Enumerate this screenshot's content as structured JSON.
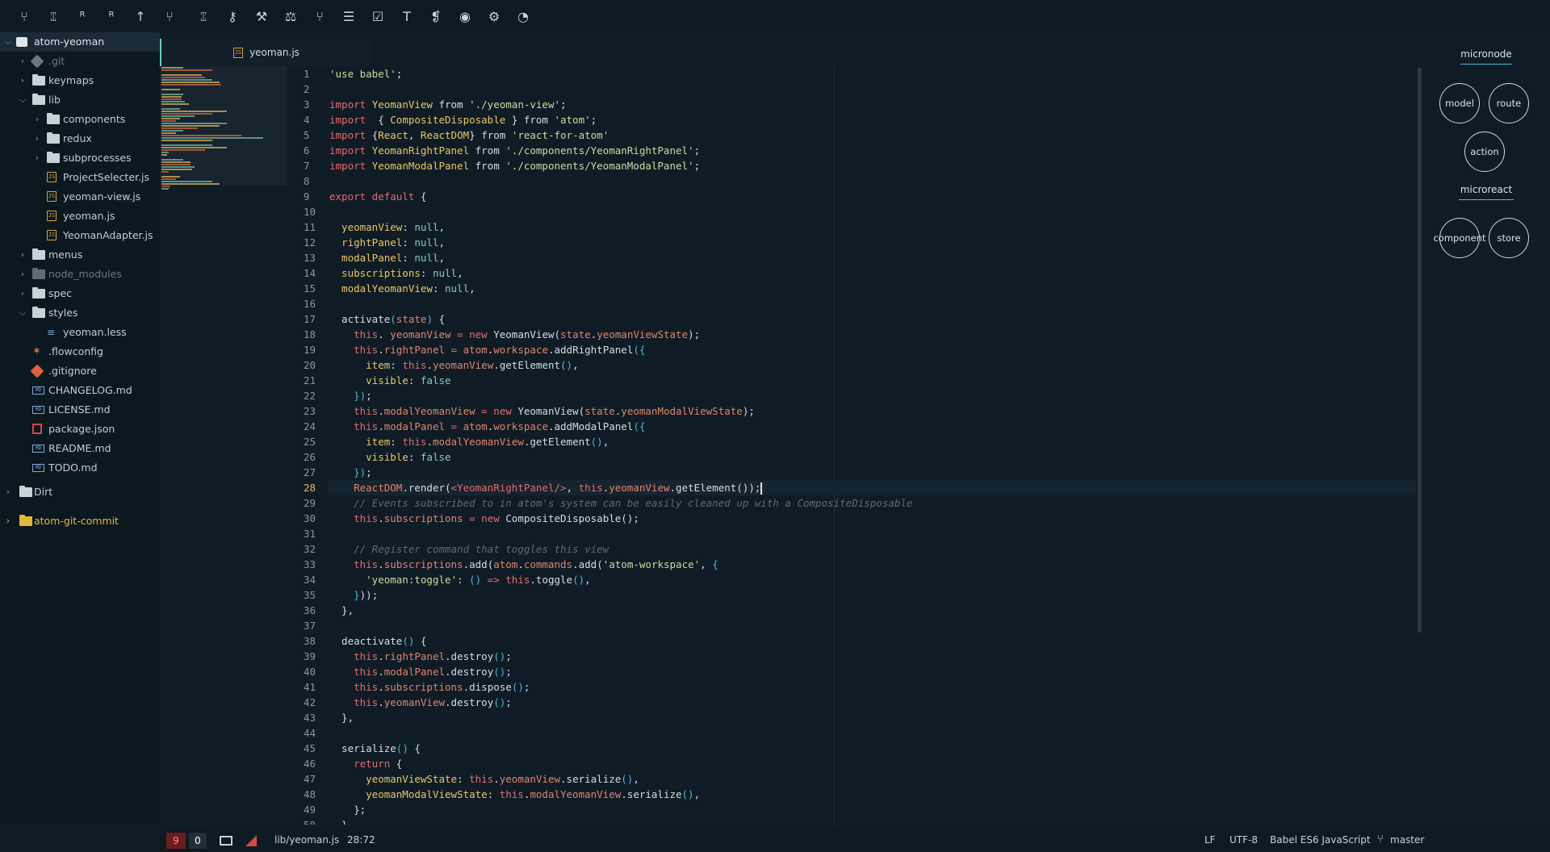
{
  "toolbar": {
    "icons": [
      "git-branch-icon",
      "git-merge-icon",
      "git-pull-icon",
      "git-fetch-icon",
      "git-push-icon",
      "git-stash-icon",
      "git-graph-icon",
      "key-icon",
      "wrench-icon",
      "balance-icon",
      "git-compare-icon",
      "list-icon",
      "checklist-icon",
      "text-icon",
      "layers-icon",
      "eye-icon",
      "gear-icon",
      "dashboard-icon"
    ],
    "glyphs": [
      "⑂",
      "⑄",
      "ᴿ",
      "ᴿ",
      "↑",
      "⑂",
      "⑄",
      "⚷",
      "⚒",
      "⚖",
      "⑂",
      "☰",
      "☑",
      "T",
      "❡",
      "◉",
      "⚙",
      "◔"
    ]
  },
  "sidebar": {
    "root": "atom-yeoman",
    "items": [
      {
        "label": ".git",
        "depth": 1,
        "kind": "git",
        "arrow": "›",
        "dim": true
      },
      {
        "label": "keymaps",
        "depth": 1,
        "kind": "folder",
        "arrow": "›"
      },
      {
        "label": "lib",
        "depth": 1,
        "kind": "folder",
        "arrow": "⌵"
      },
      {
        "label": "components",
        "depth": 2,
        "kind": "folder",
        "arrow": "›"
      },
      {
        "label": "redux",
        "depth": 2,
        "kind": "folder",
        "arrow": "›"
      },
      {
        "label": "subprocesses",
        "depth": 2,
        "kind": "folder",
        "arrow": "›"
      },
      {
        "label": "ProjectSelecter.js",
        "depth": 2,
        "kind": "js"
      },
      {
        "label": "yeoman-view.js",
        "depth": 2,
        "kind": "js"
      },
      {
        "label": "yeoman.js",
        "depth": 2,
        "kind": "js"
      },
      {
        "label": "YeomanAdapter.js",
        "depth": 2,
        "kind": "js"
      },
      {
        "label": "menus",
        "depth": 1,
        "kind": "folder",
        "arrow": "›"
      },
      {
        "label": "node_modules",
        "depth": 1,
        "kind": "folder",
        "arrow": "›",
        "dim": true
      },
      {
        "label": "spec",
        "depth": 1,
        "kind": "folder",
        "arrow": "›"
      },
      {
        "label": "styles",
        "depth": 1,
        "kind": "folder",
        "arrow": "⌵"
      },
      {
        "label": "yeoman.less",
        "depth": 2,
        "kind": "less"
      },
      {
        "label": ".flowconfig",
        "depth": 1,
        "kind": "flow"
      },
      {
        "label": ".gitignore",
        "depth": 1,
        "kind": "git"
      },
      {
        "label": "CHANGELOG.md",
        "depth": 1,
        "kind": "md"
      },
      {
        "label": "LICENSE.md",
        "depth": 1,
        "kind": "md"
      },
      {
        "label": "package.json",
        "depth": 1,
        "kind": "pkg"
      },
      {
        "label": "README.md",
        "depth": 1,
        "kind": "md"
      },
      {
        "label": "TODO.md",
        "depth": 1,
        "kind": "md"
      }
    ],
    "other_roots": [
      {
        "label": "Dirt",
        "kind": "folder",
        "color": "#c3ccd4"
      },
      {
        "label": "atom-git-commit",
        "kind": "folder-gold",
        "color": "#e2b93b"
      }
    ]
  },
  "tab": {
    "title": "yeoman.js",
    "icon": "js-file-icon"
  },
  "editor": {
    "current_line": 28,
    "lines": [
      [
        [
          "s",
          "'use babel'"
        ],
        [
          "",
          "; "
        ]
      ],
      [],
      [
        [
          "k",
          "import "
        ],
        [
          "t",
          "YeomanView"
        ],
        [
          "",
          " from "
        ],
        [
          "s",
          "'./yeoman-view'"
        ],
        [
          "",
          ";"
        ]
      ],
      [
        [
          "k",
          "import "
        ],
        [
          "",
          " { "
        ],
        [
          "t",
          "CompositeDisposable"
        ],
        [
          "",
          " } from "
        ],
        [
          "s",
          "'atom'"
        ],
        [
          "",
          ";"
        ]
      ],
      [
        [
          "k",
          "import "
        ],
        [
          "",
          "{"
        ],
        [
          "t",
          "React"
        ],
        [
          "",
          ", "
        ],
        [
          "t",
          "ReactDOM"
        ],
        [
          "",
          "} from "
        ],
        [
          "s",
          "'react-for-atom'"
        ]
      ],
      [
        [
          "k",
          "import "
        ],
        [
          "t",
          "YeomanRightPanel"
        ],
        [
          "",
          " from "
        ],
        [
          "s",
          "'./components/YeomanRightPanel'"
        ],
        [
          "",
          ";"
        ]
      ],
      [
        [
          "k",
          "import "
        ],
        [
          "t",
          "YeomanModalPanel"
        ],
        [
          "",
          " from "
        ],
        [
          "s",
          "'./components/YeomanModalPanel'"
        ],
        [
          "",
          ";"
        ]
      ],
      [],
      [
        [
          "k",
          "export default"
        ],
        [
          "",
          " {"
        ]
      ],
      [],
      [
        [
          "",
          ""
        ],
        [
          "t",
          "  yeomanView"
        ],
        [
          "",
          ": "
        ],
        [
          "n",
          "null"
        ],
        [
          "",
          ","
        ]
      ],
      [
        [
          "t",
          "  rightPanel"
        ],
        [
          "",
          ": "
        ],
        [
          "n",
          "null"
        ],
        [
          "",
          ","
        ]
      ],
      [
        [
          "t",
          "  modalPanel"
        ],
        [
          "",
          ": "
        ],
        [
          "n",
          "null"
        ],
        [
          "",
          ","
        ]
      ],
      [
        [
          "t",
          "  subscriptions"
        ],
        [
          "",
          ": "
        ],
        [
          "n",
          "null"
        ],
        [
          "",
          ","
        ]
      ],
      [
        [
          "t",
          "  modalYeomanView"
        ],
        [
          "",
          ": "
        ],
        [
          "n",
          "null"
        ],
        [
          "",
          ","
        ]
      ],
      [],
      [
        [
          "",
          "  activate"
        ],
        [
          "b",
          "("
        ],
        [
          "p",
          "state"
        ],
        [
          "b",
          ")"
        ],
        [
          "",
          " {"
        ]
      ],
      [
        [
          "k",
          "    this"
        ],
        [
          "",
          ". "
        ],
        [
          "p",
          "yeomanView"
        ],
        [
          "k",
          " = new "
        ],
        [
          "",
          "YeomanView("
        ],
        [
          "p",
          "state"
        ],
        [
          "",
          "."
        ],
        [
          "p",
          "yeomanViewState"
        ],
        [
          "",
          ");"
        ]
      ],
      [
        [
          "k",
          "    this"
        ],
        [
          "",
          "."
        ],
        [
          "p",
          "rightPanel"
        ],
        [
          "k",
          " = "
        ],
        [
          "p",
          "atom"
        ],
        [
          "",
          "."
        ],
        [
          "p",
          "workspace"
        ],
        [
          "",
          ".addRightPanel"
        ],
        [
          "b",
          "({"
        ]
      ],
      [
        [
          "t",
          "      item"
        ],
        [
          "",
          ": "
        ],
        [
          "k",
          "this"
        ],
        [
          "",
          "."
        ],
        [
          "p",
          "yeomanView"
        ],
        [
          "",
          ".getElement"
        ],
        [
          "b",
          "()"
        ],
        [
          "",
          ","
        ]
      ],
      [
        [
          "t",
          "      visible"
        ],
        [
          "",
          ": "
        ],
        [
          "n",
          "false"
        ]
      ],
      [
        [
          "b",
          "    })"
        ],
        [
          "",
          ";"
        ]
      ],
      [
        [
          "k",
          "    this"
        ],
        [
          "",
          "."
        ],
        [
          "p",
          "modalYeomanView"
        ],
        [
          "k",
          " = new "
        ],
        [
          "",
          "YeomanView("
        ],
        [
          "p",
          "state"
        ],
        [
          "",
          "."
        ],
        [
          "p",
          "yeomanModalViewState"
        ],
        [
          "",
          ");"
        ]
      ],
      [
        [
          "k",
          "    this"
        ],
        [
          "",
          "."
        ],
        [
          "p",
          "modalPanel"
        ],
        [
          "k",
          " = "
        ],
        [
          "p",
          "atom"
        ],
        [
          "",
          "."
        ],
        [
          "p",
          "workspace"
        ],
        [
          "",
          ".addModalPanel"
        ],
        [
          "b",
          "({"
        ]
      ],
      [
        [
          "t",
          "      item"
        ],
        [
          "",
          ": "
        ],
        [
          "k",
          "this"
        ],
        [
          "",
          "."
        ],
        [
          "p",
          "modalYeomanView"
        ],
        [
          "",
          ".getElement"
        ],
        [
          "b",
          "()"
        ],
        [
          "",
          ","
        ]
      ],
      [
        [
          "t",
          "      visible"
        ],
        [
          "",
          ": "
        ],
        [
          "n",
          "false"
        ]
      ],
      [
        [
          "b",
          "    })"
        ],
        [
          "",
          ";"
        ]
      ],
      [
        [
          "p",
          "    ReactDOM"
        ],
        [
          "",
          ".render("
        ],
        [
          "jx",
          "<YeomanRightPanel/>"
        ],
        [
          "",
          ", "
        ],
        [
          "k",
          "this"
        ],
        [
          "",
          "."
        ],
        [
          "p",
          "yeomanView"
        ],
        [
          "",
          ".getElement());"
        ]
      ],
      [
        [
          "c",
          "    // Events subscribed to in atom's system can be easily cleaned up with a CompositeDisposable"
        ]
      ],
      [
        [
          "k",
          "    this"
        ],
        [
          "",
          "."
        ],
        [
          "p",
          "subscriptions"
        ],
        [
          "k",
          " = new "
        ],
        [
          "",
          "CompositeDisposable();"
        ]
      ],
      [],
      [
        [
          "c",
          "    // Register command that toggles this view"
        ]
      ],
      [
        [
          "k",
          "    this"
        ],
        [
          "",
          "."
        ],
        [
          "p",
          "subscriptions"
        ],
        [
          "",
          ".add("
        ],
        [
          "p",
          "atom"
        ],
        [
          "",
          "."
        ],
        [
          "p",
          "commands"
        ],
        [
          "",
          ".add("
        ],
        [
          "s",
          "'atom-workspace'"
        ],
        [
          "",
          ", "
        ],
        [
          "b",
          "{"
        ]
      ],
      [
        [
          "s",
          "      'yeoman:toggle'"
        ],
        [
          "",
          ": "
        ],
        [
          "b",
          "()"
        ],
        [
          "k",
          " => "
        ],
        [
          "k",
          "this"
        ],
        [
          "",
          ".toggle"
        ],
        [
          "b",
          "()"
        ],
        [
          "",
          ","
        ]
      ],
      [
        [
          "b",
          "    }"
        ],
        [
          "",
          "));"
        ]
      ],
      [
        [
          "",
          "  },"
        ]
      ],
      [],
      [
        [
          "",
          "  deactivate"
        ],
        [
          "b",
          "()"
        ],
        [
          "",
          " {"
        ]
      ],
      [
        [
          "k",
          "    this"
        ],
        [
          "",
          "."
        ],
        [
          "p",
          "rightPanel"
        ],
        [
          "",
          ".destroy"
        ],
        [
          "b",
          "()"
        ],
        [
          "",
          ";"
        ]
      ],
      [
        [
          "k",
          "    this"
        ],
        [
          "",
          "."
        ],
        [
          "p",
          "modalPanel"
        ],
        [
          "",
          ".destroy"
        ],
        [
          "b",
          "()"
        ],
        [
          "",
          ";"
        ]
      ],
      [
        [
          "k",
          "    this"
        ],
        [
          "",
          "."
        ],
        [
          "p",
          "subscriptions"
        ],
        [
          "",
          ".dispose"
        ],
        [
          "b",
          "()"
        ],
        [
          "",
          ";"
        ]
      ],
      [
        [
          "k",
          "    this"
        ],
        [
          "",
          "."
        ],
        [
          "p",
          "yeomanView"
        ],
        [
          "",
          ".destroy"
        ],
        [
          "b",
          "()"
        ],
        [
          "",
          ";"
        ]
      ],
      [
        [
          "",
          "  },"
        ]
      ],
      [],
      [
        [
          "",
          "  serialize"
        ],
        [
          "b",
          "()"
        ],
        [
          "",
          " {"
        ]
      ],
      [
        [
          "k",
          "    return"
        ],
        [
          "",
          " {"
        ]
      ],
      [
        [
          "t",
          "      yeomanViewState"
        ],
        [
          "",
          ": "
        ],
        [
          "k",
          "this"
        ],
        [
          "",
          "."
        ],
        [
          "p",
          "yeomanView"
        ],
        [
          "",
          ".serialize"
        ],
        [
          "b",
          "()"
        ],
        [
          "",
          ","
        ]
      ],
      [
        [
          "t",
          "      yeomanModalViewState"
        ],
        [
          "",
          ": "
        ],
        [
          "k",
          "this"
        ],
        [
          "",
          "."
        ],
        [
          "p",
          "modalYeomanView"
        ],
        [
          "",
          ".serialize"
        ],
        [
          "b",
          "()"
        ],
        [
          "",
          ","
        ]
      ],
      [
        [
          "",
          "    };"
        ]
      ],
      [
        [
          "",
          "  }"
        ]
      ]
    ]
  },
  "rightpanel": {
    "micronode": {
      "title": "micronode",
      "nodes": [
        "model",
        "route",
        "action"
      ]
    },
    "microreact": {
      "title": "microreact",
      "nodes": [
        "component",
        "store"
      ]
    }
  },
  "statusbar": {
    "errors": "9",
    "warnings": "0",
    "terminal_icon": "terminal-icon",
    "edit_icon": "pencil-icon",
    "file_path": "lib/yeoman.js",
    "cursor_position": "28:72",
    "line_ending": "LF",
    "encoding": "UTF-8",
    "grammar": "Babel ES6 JavaScript",
    "branch_icon": "git-branch-icon",
    "branch": "master"
  }
}
